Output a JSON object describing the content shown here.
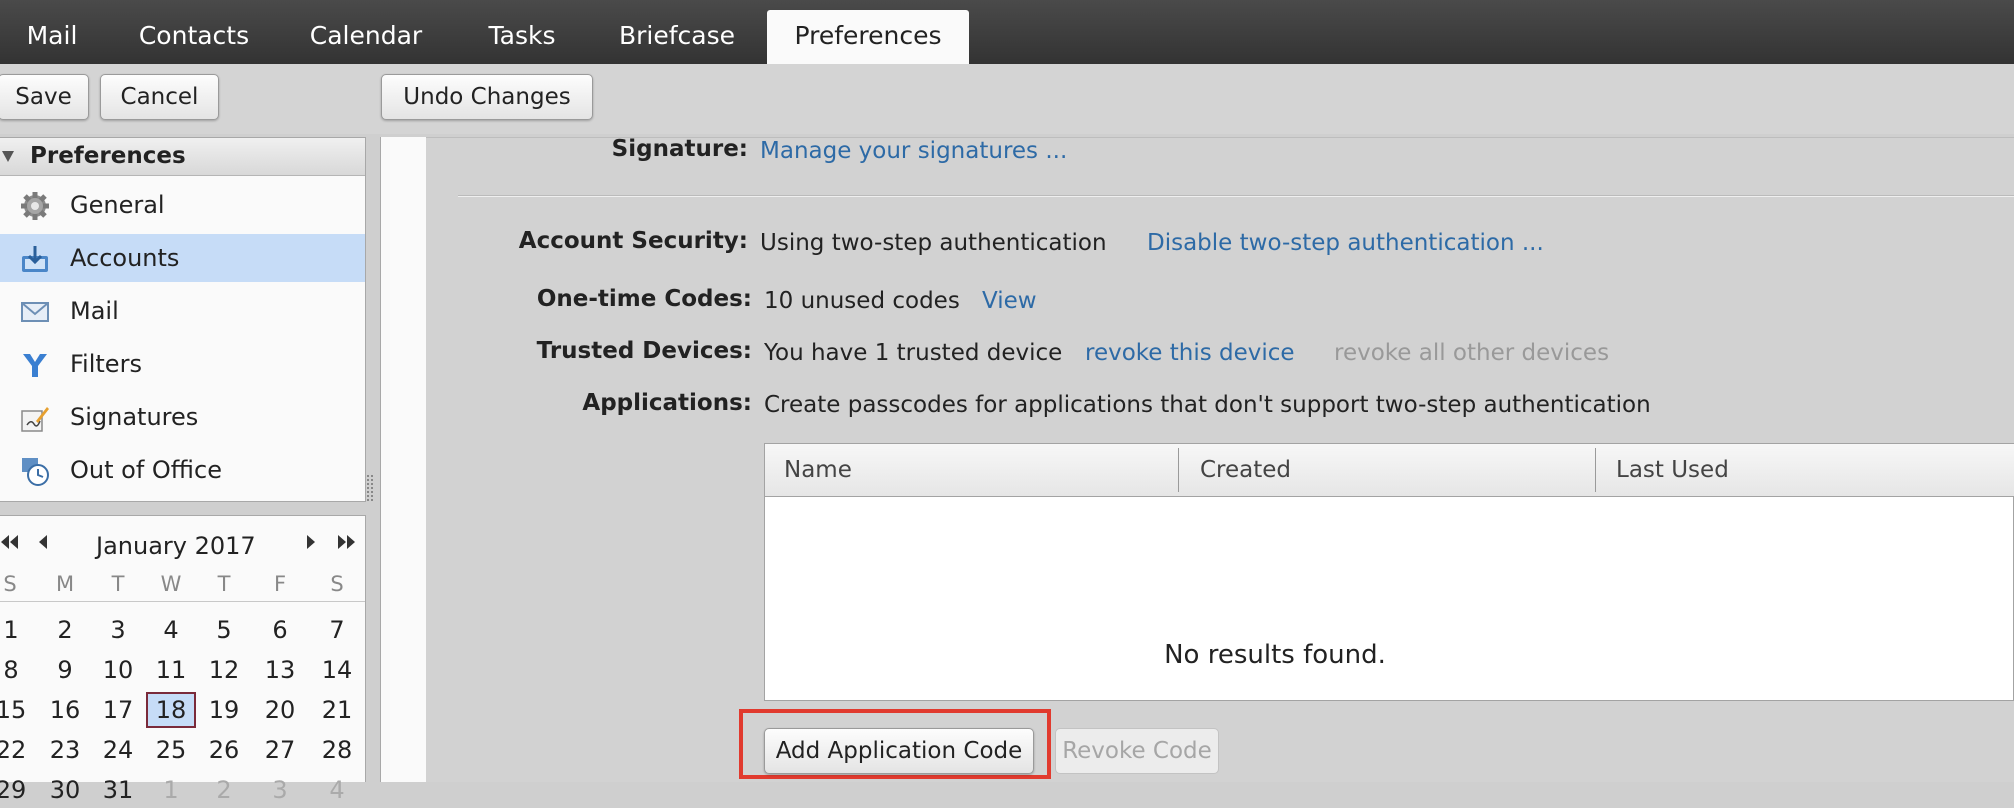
{
  "app_tabs": [
    {
      "label": "Mail"
    },
    {
      "label": "Contacts"
    },
    {
      "label": "Calendar"
    },
    {
      "label": "Tasks"
    },
    {
      "label": "Briefcase"
    },
    {
      "label": "Preferences",
      "active": true
    }
  ],
  "toolbar": {
    "save_label": "Save",
    "cancel_label": "Cancel",
    "undo_label": "Undo Changes"
  },
  "nav": {
    "header": "Preferences",
    "items": [
      {
        "label": "General",
        "icon": "gear-icon"
      },
      {
        "label": "Accounts",
        "icon": "accounts-icon",
        "selected": true
      },
      {
        "label": "Mail",
        "icon": "envelope-icon"
      },
      {
        "label": "Filters",
        "icon": "filter-icon"
      },
      {
        "label": "Signatures",
        "icon": "signature-icon"
      },
      {
        "label": "Out of Office",
        "icon": "clock-icon"
      }
    ]
  },
  "calendar": {
    "month_title": "January 2017",
    "weekdays": [
      "S",
      "M",
      "T",
      "W",
      "T",
      "F",
      "S"
    ],
    "weeks": [
      [
        "1",
        "2",
        "3",
        "4",
        "5",
        "6",
        "7"
      ],
      [
        "8",
        "9",
        "10",
        "11",
        "12",
        "13",
        "14"
      ],
      [
        "15",
        "16",
        "17",
        "18",
        "19",
        "20",
        "21"
      ],
      [
        "22",
        "23",
        "24",
        "25",
        "26",
        "27",
        "28"
      ],
      [
        "29",
        "30",
        "31",
        "1",
        "2",
        "3",
        "4"
      ]
    ],
    "today": "18"
  },
  "settings": {
    "signature_label": "Signature:",
    "signature_link": "Manage your signatures ...",
    "security_label": "Account Security:",
    "security_value": "Using two-step authentication",
    "security_link": "Disable two-step authentication ...",
    "codes_label": "One-time Codes:",
    "codes_value": "10 unused codes",
    "codes_link": "View",
    "devices_label": "Trusted Devices:",
    "devices_value": "You have 1 trusted device",
    "devices_link": "revoke this device",
    "devices_link_disabled": "revoke all other devices",
    "apps_label": "Applications:",
    "apps_value": "Create passcodes for applications that don't support two-step authentication"
  },
  "app_codes_table": {
    "columns": [
      "Name",
      "Created",
      "Last Used"
    ],
    "rows": [],
    "empty_message": "No results found."
  },
  "actions": {
    "add_label": "Add Application Code",
    "revoke_label": "Revoke Code"
  }
}
